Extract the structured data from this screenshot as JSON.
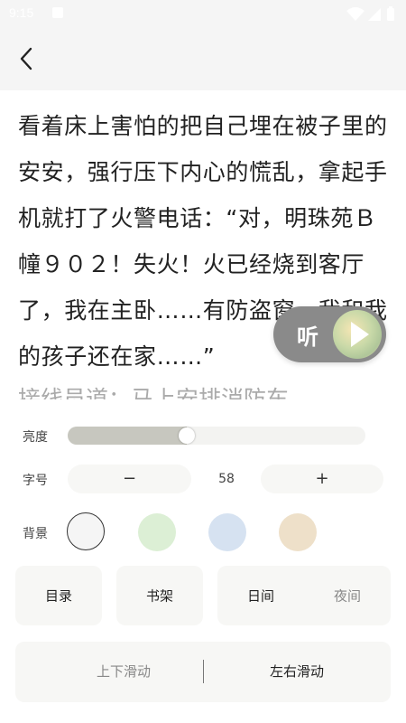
{
  "status": {
    "time": "9:15"
  },
  "header": {
    "back_icon": "chevron-left-icon"
  },
  "reader": {
    "text": "看着床上害怕的把自己埋在被子里的安安，强行压下内心的慌乱，拿起手机就打了火警电话：“对，明珠苑Ｂ幢９０２！失火！火已经烧到客厅了，我在主卧……有防盗窗，我和我的孩子还在家……”",
    "next_line_partial": "接线员道：马上安排消防车，"
  },
  "listen": {
    "label": "听",
    "icon": "play-icon"
  },
  "settings": {
    "brightness": {
      "label": "亮度",
      "value": 0.4
    },
    "font_size": {
      "label": "字号",
      "decrease": "−",
      "value": "58",
      "increase": "+"
    },
    "background": {
      "label": "背景",
      "swatches": [
        {
          "color": "#f5f5f5",
          "selected": true
        },
        {
          "color": "#dcefd5",
          "selected": false
        },
        {
          "color": "#d6e2f1",
          "selected": false
        },
        {
          "color": "#eee0c9",
          "selected": false
        }
      ]
    },
    "buttons": {
      "toc": "目录",
      "bookshelf": "书架",
      "day": "日间",
      "night": "夜间"
    },
    "scroll_mode": {
      "vertical": "上下滑动",
      "horizontal": "左右滑动",
      "selected": "horizontal"
    }
  },
  "colors": {
    "panel_bg": "#ffffff",
    "card_bg": "#f7f7f5",
    "slider_fill": "#c7c7bf"
  }
}
